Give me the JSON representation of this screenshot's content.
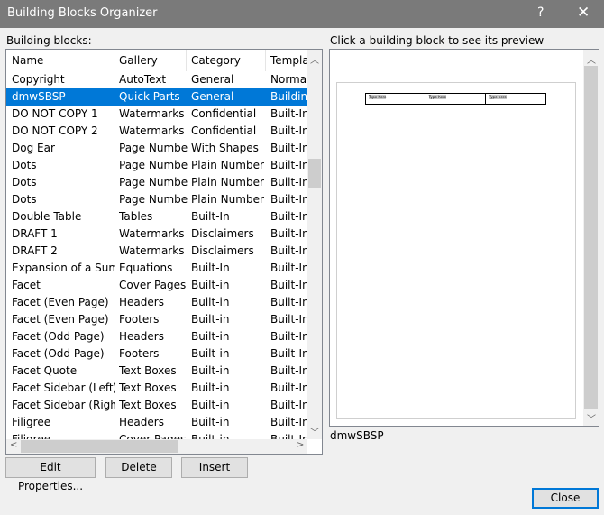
{
  "window": {
    "title": "Building Blocks Organizer",
    "help": "?",
    "close": "✕"
  },
  "list_label": "Building blocks:",
  "preview_label": "Click a building block to see its preview",
  "columns": [
    "Name",
    "Gallery",
    "Category",
    "Template"
  ],
  "rows": [
    [
      "Copyright",
      "AutoText",
      "General",
      "Normal"
    ],
    [
      "dmwSBSP",
      "Quick Parts",
      "General",
      "Building"
    ],
    [
      "DO NOT COPY 1",
      "Watermarks",
      "Confidential",
      "Built-In"
    ],
    [
      "DO NOT COPY 2",
      "Watermarks",
      "Confidential",
      "Built-In"
    ],
    [
      "Dog Ear",
      "Page Numbers",
      "With Shapes",
      "Built-In"
    ],
    [
      "Dots",
      "Page Numbers",
      "Plain Number",
      "Built-In"
    ],
    [
      "Dots",
      "Page Numbers",
      "Plain Number",
      "Built-In"
    ],
    [
      "Dots",
      "Page Numbers",
      "Plain Number",
      "Built-In"
    ],
    [
      "Double Table",
      "Tables",
      "Built-In",
      "Built-In"
    ],
    [
      "DRAFT 1",
      "Watermarks",
      "Disclaimers",
      "Built-In"
    ],
    [
      "DRAFT 2",
      "Watermarks",
      "Disclaimers",
      "Built-In"
    ],
    [
      "Expansion of a Sum",
      "Equations",
      "Built-In",
      "Built-In"
    ],
    [
      "Facet",
      "Cover Pages",
      "Built-in",
      "Built-In"
    ],
    [
      "Facet (Even Page)",
      "Headers",
      "Built-in",
      "Built-In"
    ],
    [
      "Facet (Even Page)",
      "Footers",
      "Built-in",
      "Built-In"
    ],
    [
      "Facet (Odd Page)",
      "Headers",
      "Built-in",
      "Built-In"
    ],
    [
      "Facet (Odd Page)",
      "Footers",
      "Built-in",
      "Built-In"
    ],
    [
      "Facet Quote",
      "Text Boxes",
      "Built-in",
      "Built-In"
    ],
    [
      "Facet Sidebar (Left)",
      "Text Boxes",
      "Built-in",
      "Built-In"
    ],
    [
      "Facet Sidebar (Right)",
      "Text Boxes",
      "Built-in",
      "Built-In"
    ],
    [
      "Filigree",
      "Headers",
      "Built-in",
      "Built-In"
    ],
    [
      "Filigree",
      "Cover Pages",
      "Built-in",
      "Built-In"
    ]
  ],
  "selected_index": 1,
  "preview": {
    "cells": [
      "Type here",
      "Type here",
      "Type here"
    ],
    "name": "dmwSBSP"
  },
  "buttons": {
    "edit": "Edit Properties...",
    "delete": "Delete",
    "insert": "Insert",
    "close": "Close"
  },
  "colors": {
    "selection": "#0078d7",
    "titlebar": "#7a7a7a"
  }
}
